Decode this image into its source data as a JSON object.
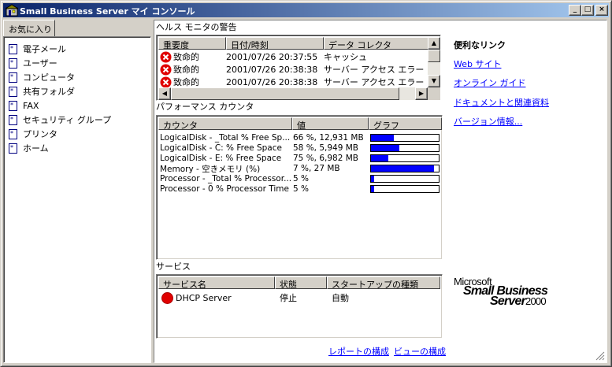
{
  "window": {
    "title": "Small Business Server マイ コンソール",
    "controls": {
      "minimize": "_",
      "maximize": "□",
      "close": "×"
    }
  },
  "sidebar": {
    "tab_label": "お気に入り",
    "items": [
      {
        "label": "電子メール"
      },
      {
        "label": "ユーザー"
      },
      {
        "label": "コンピュータ"
      },
      {
        "label": "共有フォルダ"
      },
      {
        "label": "FAX"
      },
      {
        "label": "セキュリティ グループ"
      },
      {
        "label": "プリンタ"
      },
      {
        "label": "ホーム"
      }
    ]
  },
  "health": {
    "title": "ヘルス モニタの警告",
    "columns": [
      "重要度",
      "日付/時刻",
      "データ コレクタ"
    ],
    "rows": [
      {
        "severity": "致命的",
        "datetime": "2001/07/26 20:37:55",
        "collector": "キャッシュ"
      },
      {
        "severity": "致命的",
        "datetime": "2001/07/26 20:38:38",
        "collector": "サーバー アクセス エラー"
      },
      {
        "severity": "致命的",
        "datetime": "2001/07/26 20:38:38",
        "collector": "サーバー アクセス エラー"
      }
    ]
  },
  "performance": {
    "title": "パフォーマンス カウンタ",
    "columns": [
      "カウンタ",
      "値",
      "グラフ"
    ],
    "rows": [
      {
        "counter": "LogicalDisk - _Total % Free Sp...",
        "value": "66 %, 12,931 MB",
        "percent": 34
      },
      {
        "counter": "LogicalDisk - C: % Free Space",
        "value": "58 %, 5,949 MB",
        "percent": 42
      },
      {
        "counter": "LogicalDisk - E: % Free Space",
        "value": "75 %, 6,982 MB",
        "percent": 25
      },
      {
        "counter": "Memory - 空きメモリ (%)",
        "value": "7 %, 27 MB",
        "percent": 93
      },
      {
        "counter": "Processor - _Total % Processor...",
        "value": "5 %",
        "percent": 5
      },
      {
        "counter": "Processor - 0 % Processor Time",
        "value": "5 %",
        "percent": 5
      }
    ]
  },
  "services": {
    "title": "サービス",
    "columns": [
      "サービス名",
      "状態",
      "スタートアップの種類"
    ],
    "rows": [
      {
        "name": "DHCP Server",
        "state": "停止",
        "startup": "自動"
      }
    ]
  },
  "links": {
    "title": "便利なリンク",
    "items": [
      "Web サイト",
      "オンライン ガイド",
      "ドキュメントと関連資料",
      "バージョン情報..."
    ]
  },
  "footer_links": {
    "report": "レポートの構成",
    "view": "ビューの構成"
  },
  "logo": {
    "line1": "Microsoft",
    "line2": "Small Business",
    "line3": "Server",
    "year": "2000"
  },
  "colors": {
    "title_gradient_start": "#0a246a",
    "title_gradient_end": "#a6caf0",
    "link": "#0000ff",
    "bar_fill": "#0000ff",
    "error_red": "#e00000"
  }
}
